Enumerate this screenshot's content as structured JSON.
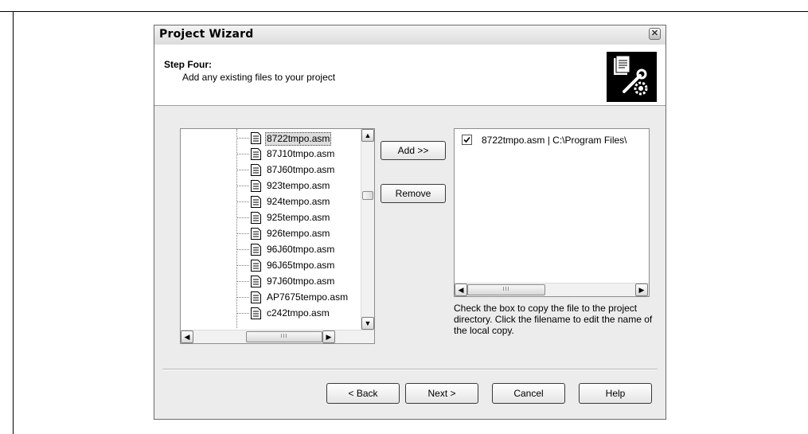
{
  "dialog": {
    "title": "Project Wizard",
    "close_glyph": "✕"
  },
  "header": {
    "step_title": "Step Four:",
    "step_description": "Add any existing files to your project"
  },
  "tree": {
    "items": [
      {
        "label": "8722tmpo.asm"
      },
      {
        "label": "87J10tmpo.asm"
      },
      {
        "label": "87J60tmpo.asm"
      },
      {
        "label": "923tempo.asm"
      },
      {
        "label": "924tempo.asm"
      },
      {
        "label": "925tempo.asm"
      },
      {
        "label": "926tempo.asm"
      },
      {
        "label": "96J60tmpo.asm"
      },
      {
        "label": "96J65tmpo.asm"
      },
      {
        "label": "97J60tmpo.asm"
      },
      {
        "label": "AP7675tempo.asm"
      },
      {
        "label": "c242tmpo.asm"
      }
    ],
    "selected_index": 0
  },
  "buttons": {
    "add": "Add >>",
    "remove": "Remove",
    "back": "< Back",
    "next": "Next >",
    "cancel": "Cancel",
    "help": "Help"
  },
  "project_files": {
    "items": [
      {
        "label": "8722tmpo.asm | C:\\Program Files\\",
        "checked": true
      }
    ]
  },
  "hint_text": "Check the box to copy the file to the project directory.  Click the filename to edit the name of the local copy.",
  "icons": {
    "arrow_up": "▲",
    "arrow_down": "▼",
    "arrow_left": "◀",
    "arrow_right": "▶",
    "thumb_grip": "III",
    "check": "✓"
  }
}
